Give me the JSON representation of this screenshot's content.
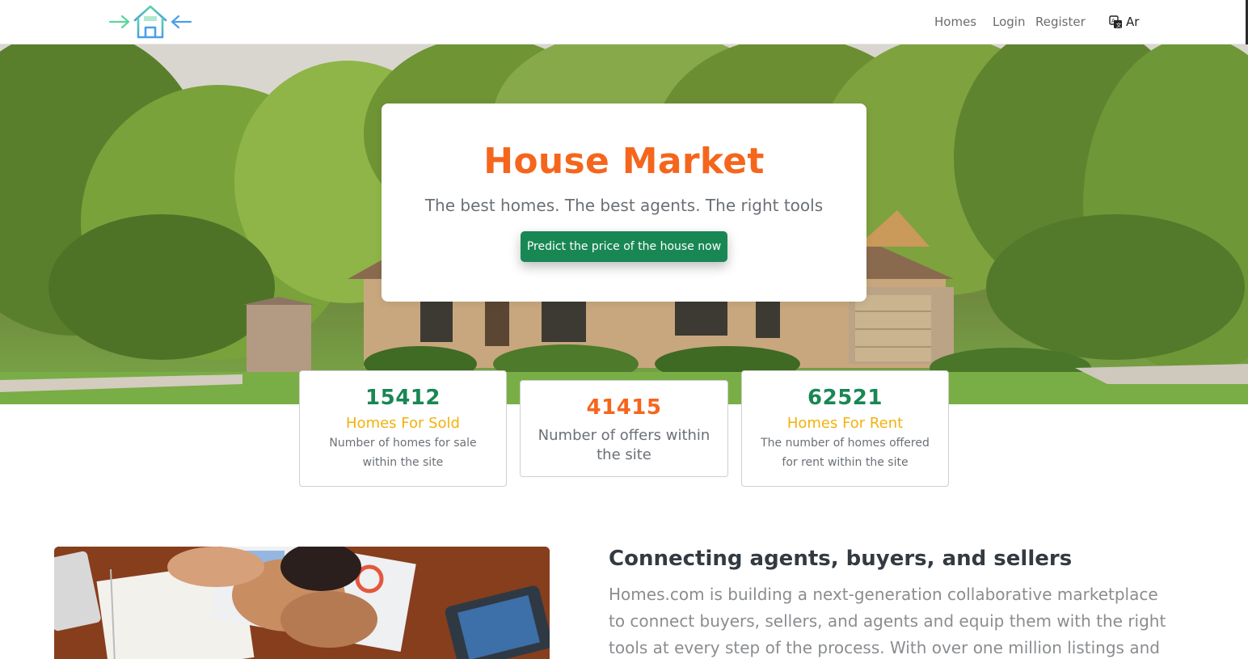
{
  "nav": {
    "links": [
      "Homes",
      "Login",
      "Register"
    ],
    "language_label": "Ar"
  },
  "hero": {
    "title": "House Market",
    "subtitle": "The best homes. The best agents. The right tools",
    "cta_label": "Predict the price of the house now"
  },
  "stats": [
    {
      "number": "15412",
      "heading": "Homes For Sold",
      "description": "Number of homes for sale within the site"
    },
    {
      "number": "41415",
      "description": "Number of offers within the site"
    },
    {
      "number": "62521",
      "heading": "Homes For Rent",
      "description": "The number of homes offered for rent within the site"
    }
  ],
  "about": {
    "title": "Connecting agents, buyers, and sellers",
    "text": "Homes.com is building a next-generation collaborative marketplace to connect buyers, sellers, and agents and equip them with the right tools at every step of the process. With over one million listings and innovative"
  },
  "colors": {
    "brand_orange": "#f5661d",
    "brand_green": "#198754",
    "accent_yellow": "#f1b20c"
  }
}
